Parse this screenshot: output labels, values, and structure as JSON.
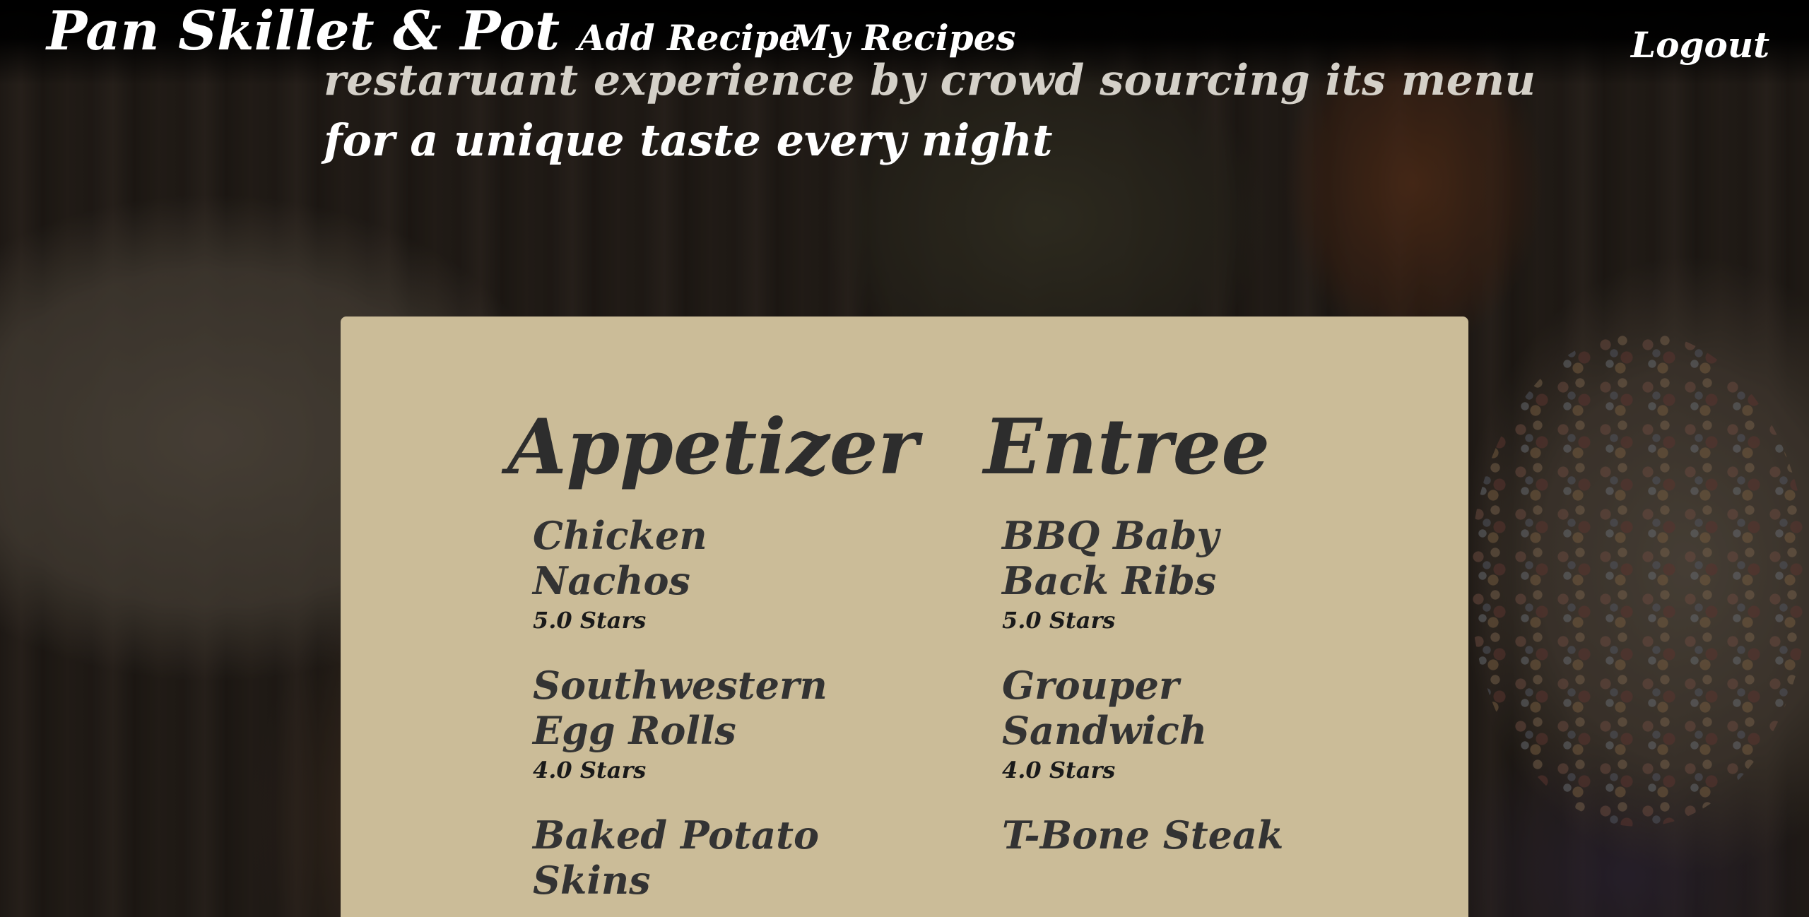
{
  "header": {
    "brand": "Pan Skillet & Pot",
    "nav": {
      "add_recipe": "Add Recipe",
      "my_recipes": "My Recipes",
      "logout": "Logout"
    }
  },
  "hero": {
    "tagline_line1": "restaruant experience by crowd sourcing its menu",
    "tagline_line2": "for a unique taste every night"
  },
  "menu": {
    "appetizer": {
      "heading": "Appetizer",
      "items": [
        {
          "name": "Chicken Nachos",
          "rating": "5.0 Stars"
        },
        {
          "name": "Southwestern Egg Rolls",
          "rating": "4.0 Stars"
        },
        {
          "name": "Baked Potato Skins",
          "rating": ""
        }
      ]
    },
    "entree": {
      "heading": "Entree",
      "items": [
        {
          "name": "BBQ Baby Back Ribs",
          "rating": "5.0 Stars"
        },
        {
          "name": "Grouper Sandwich",
          "rating": "4.0 Stars"
        },
        {
          "name": "T-Bone Steak",
          "rating": ""
        }
      ]
    }
  },
  "colors": {
    "card_background": "#cbbc98",
    "heading_text": "#2d2d2d",
    "header_background": "#000000",
    "header_text": "#ffffff"
  }
}
